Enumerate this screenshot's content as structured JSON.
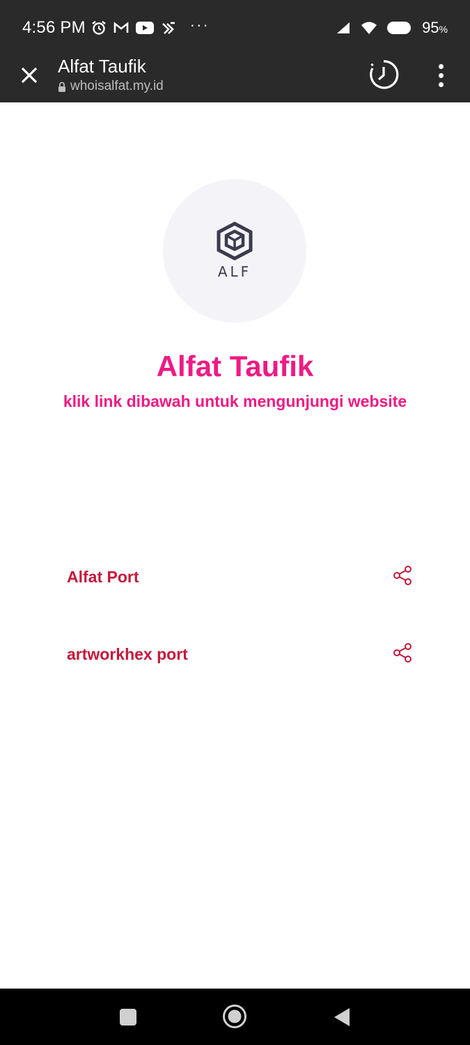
{
  "status_bar": {
    "time": "4:56 PM",
    "icons": [
      "alarm-icon",
      "gmail-icon",
      "youtube-icon",
      "xl-icon"
    ],
    "more": "···",
    "battery": "95",
    "battery_unit": "%"
  },
  "toolbar": {
    "title": "Alfat Taufik",
    "url": "whoisalfat.my.id"
  },
  "profile": {
    "logo_text": "ALF",
    "name": "Alfat Taufik",
    "description": "klik link dibawah untuk mengunjungi website"
  },
  "links": [
    {
      "label": "Alfat Port"
    },
    {
      "label": "artworkhex port"
    }
  ],
  "colors": {
    "accent": "#ee1b84",
    "link": "#c4183c",
    "bar": "#2a2a2a"
  }
}
